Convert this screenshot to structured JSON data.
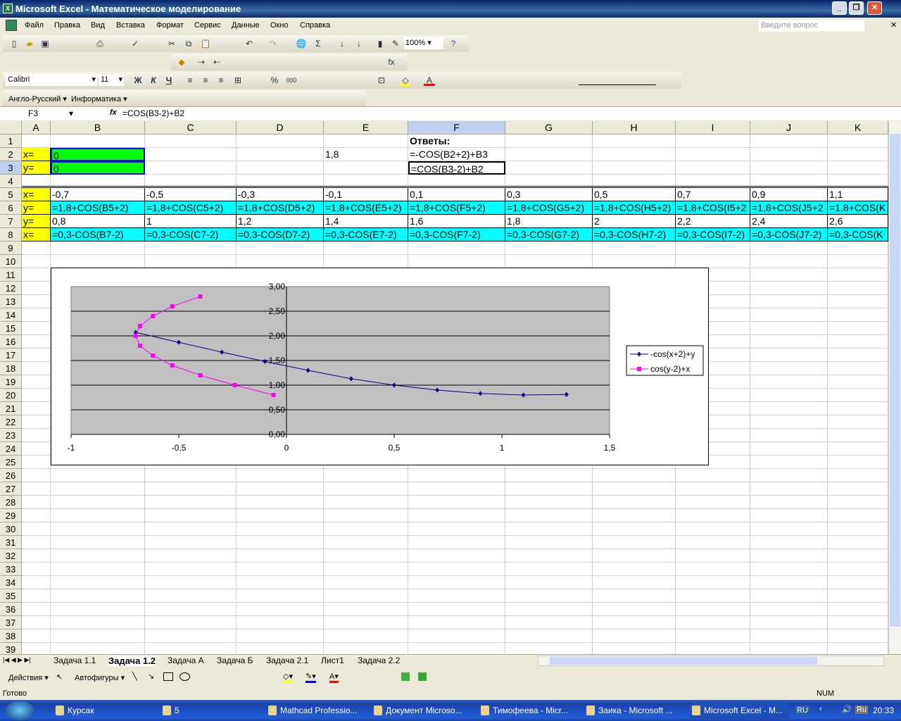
{
  "window": {
    "title": "Microsoft Excel - Математическое моделирование"
  },
  "menu": {
    "items": [
      "Файл",
      "Правка",
      "Вид",
      "Вставка",
      "Формат",
      "Сервис",
      "Данные",
      "Окно",
      "Справка"
    ],
    "help_placeholder": "Введите вопрос"
  },
  "standard_toolbar": {
    "zoom": "100%"
  },
  "format_toolbar": {
    "font": "Calibri",
    "size": "11",
    "bold": "Ж",
    "italic": "К",
    "underline": "Ч"
  },
  "custom_toolbar": {
    "dict": "Англо-Русский",
    "info": "Информатика"
  },
  "formula_bar": {
    "name_box": "F3",
    "fx": "fx",
    "formula": "=COS(B3-2)+B2"
  },
  "columns": [
    "A",
    "B",
    "C",
    "D",
    "E",
    "F",
    "G",
    "H",
    "I",
    "J",
    "K"
  ],
  "selected_cell": "F3",
  "colors": {
    "yellow": "#ffff00",
    "green": "#00ff00",
    "cyan": "#00ffff",
    "series1": "#000080",
    "series2": "#ff00ff",
    "plot_bg": "#c0c0c0"
  },
  "cells": [
    {
      "ref": "F1",
      "text": "Ответы:",
      "bold": true
    },
    {
      "ref": "A2",
      "text": "x=",
      "fill": "yellow"
    },
    {
      "ref": "B2",
      "text": "0",
      "fill": "green"
    },
    {
      "ref": "E2",
      "text": "1,8"
    },
    {
      "ref": "F2",
      "text": "=-COS(B2+2)+B3"
    },
    {
      "ref": "A3",
      "text": "y=",
      "fill": "yellow"
    },
    {
      "ref": "B3",
      "text": "0",
      "fill": "green"
    },
    {
      "ref": "F3",
      "text": "=COS(B3-2)+B2"
    },
    {
      "ref": "A5",
      "text": "x=",
      "fill": "yellow"
    },
    {
      "ref": "B5",
      "text": "-0,7"
    },
    {
      "ref": "C5",
      "text": "-0,5"
    },
    {
      "ref": "D5",
      "text": "-0,3"
    },
    {
      "ref": "E5",
      "text": "-0,1"
    },
    {
      "ref": "F5",
      "text": "0,1"
    },
    {
      "ref": "G5",
      "text": "0,3"
    },
    {
      "ref": "H5",
      "text": "0,5"
    },
    {
      "ref": "I5",
      "text": "0,7"
    },
    {
      "ref": "J5",
      "text": "0,9"
    },
    {
      "ref": "K5",
      "text": "1,1"
    },
    {
      "ref": "A6",
      "text": "y=",
      "fill": "yellow"
    },
    {
      "ref": "B6",
      "text": "=1,8+COS(B5+2)",
      "fill": "cyan"
    },
    {
      "ref": "C6",
      "text": "=1,8+COS(C5+2)",
      "fill": "cyan"
    },
    {
      "ref": "D6",
      "text": "=1,8+COS(D5+2)",
      "fill": "cyan"
    },
    {
      "ref": "E6",
      "text": "=1,8+COS(E5+2)",
      "fill": "cyan"
    },
    {
      "ref": "F6",
      "text": "=1,8+COS(F5+2)",
      "fill": "cyan"
    },
    {
      "ref": "G6",
      "text": "=1,8+COS(G5+2)",
      "fill": "cyan"
    },
    {
      "ref": "H6",
      "text": "=1,8+COS(H5+2)",
      "fill": "cyan"
    },
    {
      "ref": "I6",
      "text": "=1,8+COS(I5+2",
      "fill": "cyan"
    },
    {
      "ref": "J6",
      "text": "=1,8+COS(J5+2",
      "fill": "cyan"
    },
    {
      "ref": "K6",
      "text": "=1,8+COS(K",
      "fill": "cyan"
    },
    {
      "ref": "A7",
      "text": "y=",
      "fill": "yellow"
    },
    {
      "ref": "B7",
      "text": "0,8"
    },
    {
      "ref": "C7",
      "text": "1"
    },
    {
      "ref": "D7",
      "text": "1,2"
    },
    {
      "ref": "E7",
      "text": "1,4"
    },
    {
      "ref": "F7",
      "text": "1,6"
    },
    {
      "ref": "G7",
      "text": "1,8"
    },
    {
      "ref": "H7",
      "text": "2"
    },
    {
      "ref": "I7",
      "text": "2,2"
    },
    {
      "ref": "J7",
      "text": "2,4"
    },
    {
      "ref": "K7",
      "text": "2,6"
    },
    {
      "ref": "A8",
      "text": "x=",
      "fill": "yellow"
    },
    {
      "ref": "B8",
      "text": "=0,3-COS(B7-2)",
      "fill": "cyan"
    },
    {
      "ref": "C8",
      "text": "=0,3-COS(C7-2)",
      "fill": "cyan"
    },
    {
      "ref": "D8",
      "text": "=0,3-COS(D7-2)",
      "fill": "cyan"
    },
    {
      "ref": "E8",
      "text": "=0,3-COS(E7-2)",
      "fill": "cyan"
    },
    {
      "ref": "F8",
      "text": "=0,3-COS(F7-2)",
      "fill": "cyan"
    },
    {
      "ref": "G8",
      "text": "=0,3-COS(G7-2)",
      "fill": "cyan"
    },
    {
      "ref": "H8",
      "text": "=0,3-COS(H7-2)",
      "fill": "cyan"
    },
    {
      "ref": "I8",
      "text": "=0,3-COS(I7-2)",
      "fill": "cyan"
    },
    {
      "ref": "J8",
      "text": "=0,3-COS(J7-2)",
      "fill": "cyan"
    },
    {
      "ref": "K8",
      "text": "=0,3-COS(K",
      "fill": "cyan"
    }
  ],
  "chart_data": {
    "type": "scatter",
    "xlim": [
      -1,
      1.5
    ],
    "ylim": [
      0,
      3
    ],
    "xticks": [
      "-1",
      "-0,5",
      "0",
      "0,5",
      "1",
      "1,5"
    ],
    "yticks": [
      "0,00",
      "0,50",
      "1,00",
      "1,50",
      "2,00",
      "2,50",
      "3,00"
    ],
    "grid": true,
    "legend": "right",
    "series": [
      {
        "name": "-cos(x+2)+y",
        "color": "#000080",
        "marker": "diamond",
        "x": [
          -0.7,
          -0.5,
          -0.3,
          -0.1,
          0.1,
          0.3,
          0.5,
          0.7,
          0.9,
          1.1,
          1.3
        ],
        "y": [
          2.07,
          1.87,
          1.67,
          1.48,
          1.3,
          1.13,
          1.0,
          0.9,
          0.83,
          0.8,
          0.81
        ]
      },
      {
        "name": "cos(y-2)+x",
        "color": "#ff00ff",
        "marker": "square",
        "x": [
          -0.06,
          -0.24,
          -0.4,
          -0.53,
          -0.62,
          -0.68,
          -0.7,
          -0.68,
          -0.62,
          -0.53,
          -0.4
        ],
        "y": [
          0.8,
          1.0,
          1.2,
          1.4,
          1.6,
          1.8,
          2.0,
          2.2,
          2.4,
          2.6,
          2.8
        ]
      }
    ]
  },
  "sheet_tabs": [
    "Задача 1.1",
    "Задача 1.2",
    "Задача А",
    "Задача Б",
    "Задача 2.1",
    "Лист1",
    "Задача 2.2"
  ],
  "active_tab": "Задача 1.2",
  "drawing_toolbar": {
    "actions": "Действия",
    "autoshapes": "Автофигуры"
  },
  "status": {
    "ready": "Готово",
    "num": "NUM"
  },
  "taskbar": {
    "items": [
      "Курсак",
      "5",
      "Mathcad Professio...",
      "Документ Microso...",
      "Тимофеева - Micr...",
      "Заика - Microsoft ...",
      "Microsoft Excel - M..."
    ],
    "lang": "RU",
    "tray_lang": "Ru",
    "clock": "20:33"
  }
}
